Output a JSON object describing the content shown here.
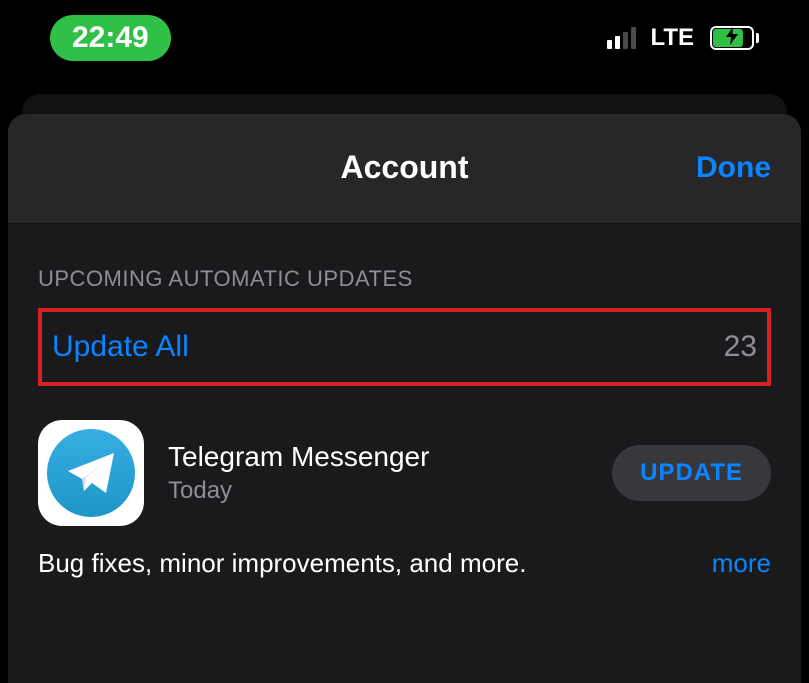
{
  "status_bar": {
    "time": "22:49",
    "network_label": "LTE"
  },
  "nav": {
    "title": "Account",
    "done": "Done"
  },
  "section": {
    "header": "UPCOMING AUTOMATIC UPDATES",
    "update_all": "Update All",
    "update_count": "23"
  },
  "apps": [
    {
      "name": "Telegram Messenger",
      "date": "Today",
      "button": "UPDATE",
      "release_notes": "Bug fixes, minor improvements, and more.",
      "more": "more"
    }
  ]
}
